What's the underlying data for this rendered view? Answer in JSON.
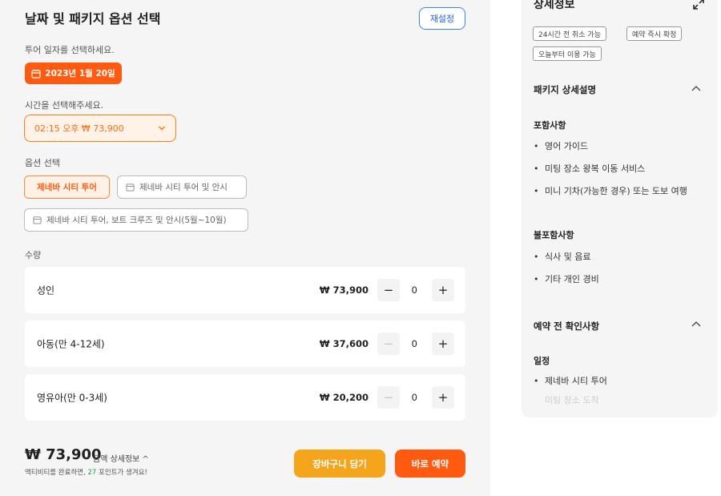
{
  "left": {
    "title": "날짜 및 패키지 옵션 선택",
    "reset_label": "재설정",
    "date_prompt": "투어 일자를 선택하세요.",
    "selected_date": "2023년 1월 20일",
    "time_prompt": "시간을 선택해주세요.",
    "selected_time": "02:15 오후 ₩ 73,900",
    "option_prompt": "옵션 선택",
    "options": [
      {
        "label": "제네바 시티 투어",
        "selected": true
      },
      {
        "label": "제네바 시티 투어 및 안시",
        "selected": false
      },
      {
        "label": "제네바 시티 투어, 보트 크루즈 및 안시(5월~10월)",
        "selected": false
      }
    ],
    "quantity_label": "수량",
    "quantities": [
      {
        "label": "성인",
        "price": "₩ 73,900",
        "count": "0",
        "minus_enabled": true
      },
      {
        "label": "아동(만 4-12세)",
        "price": "₩ 37,600",
        "count": "0",
        "minus_enabled": false
      },
      {
        "label": "영유아(만 0-3세)",
        "price": "₩ 20,200",
        "count": "0",
        "minus_enabled": false
      }
    ],
    "total_price": "₩ 73,900",
    "detail_link": "금액 상세정보 ^",
    "points_prefix": "액티비티를 완료하면, ",
    "points_value": "27",
    "points_suffix": " 포인트가 생겨요!",
    "cart_label": "장바구니 담기",
    "book_label": "바로 예약"
  },
  "right": {
    "title": "상세정보",
    "tags": [
      "24시간 전 취소 가능",
      "예약 즉시 확정",
      "오늘부터 이용 가능"
    ],
    "package_heading": "패키지 상세설명",
    "included_heading": "포함사항",
    "included": [
      "영어 가이드",
      "미팅 장소 왕복 이동 서비스",
      "미니 기차(가능한 경우) 또는 도보 여행"
    ],
    "excluded_heading": "불포함사항",
    "excluded": [
      "식사 및 음료",
      "기타 개인 경비"
    ],
    "prebook_heading": "예약 전 확인사항",
    "schedule_heading": "일정",
    "schedule": [
      "제네바 시티 투어"
    ],
    "schedule_faded": "미팅 장소 도착"
  },
  "colors": {
    "accent": "#ff5a0f",
    "cart": "#f5a51b",
    "link_blue": "#2563eb",
    "points_green": "#16a34a"
  }
}
